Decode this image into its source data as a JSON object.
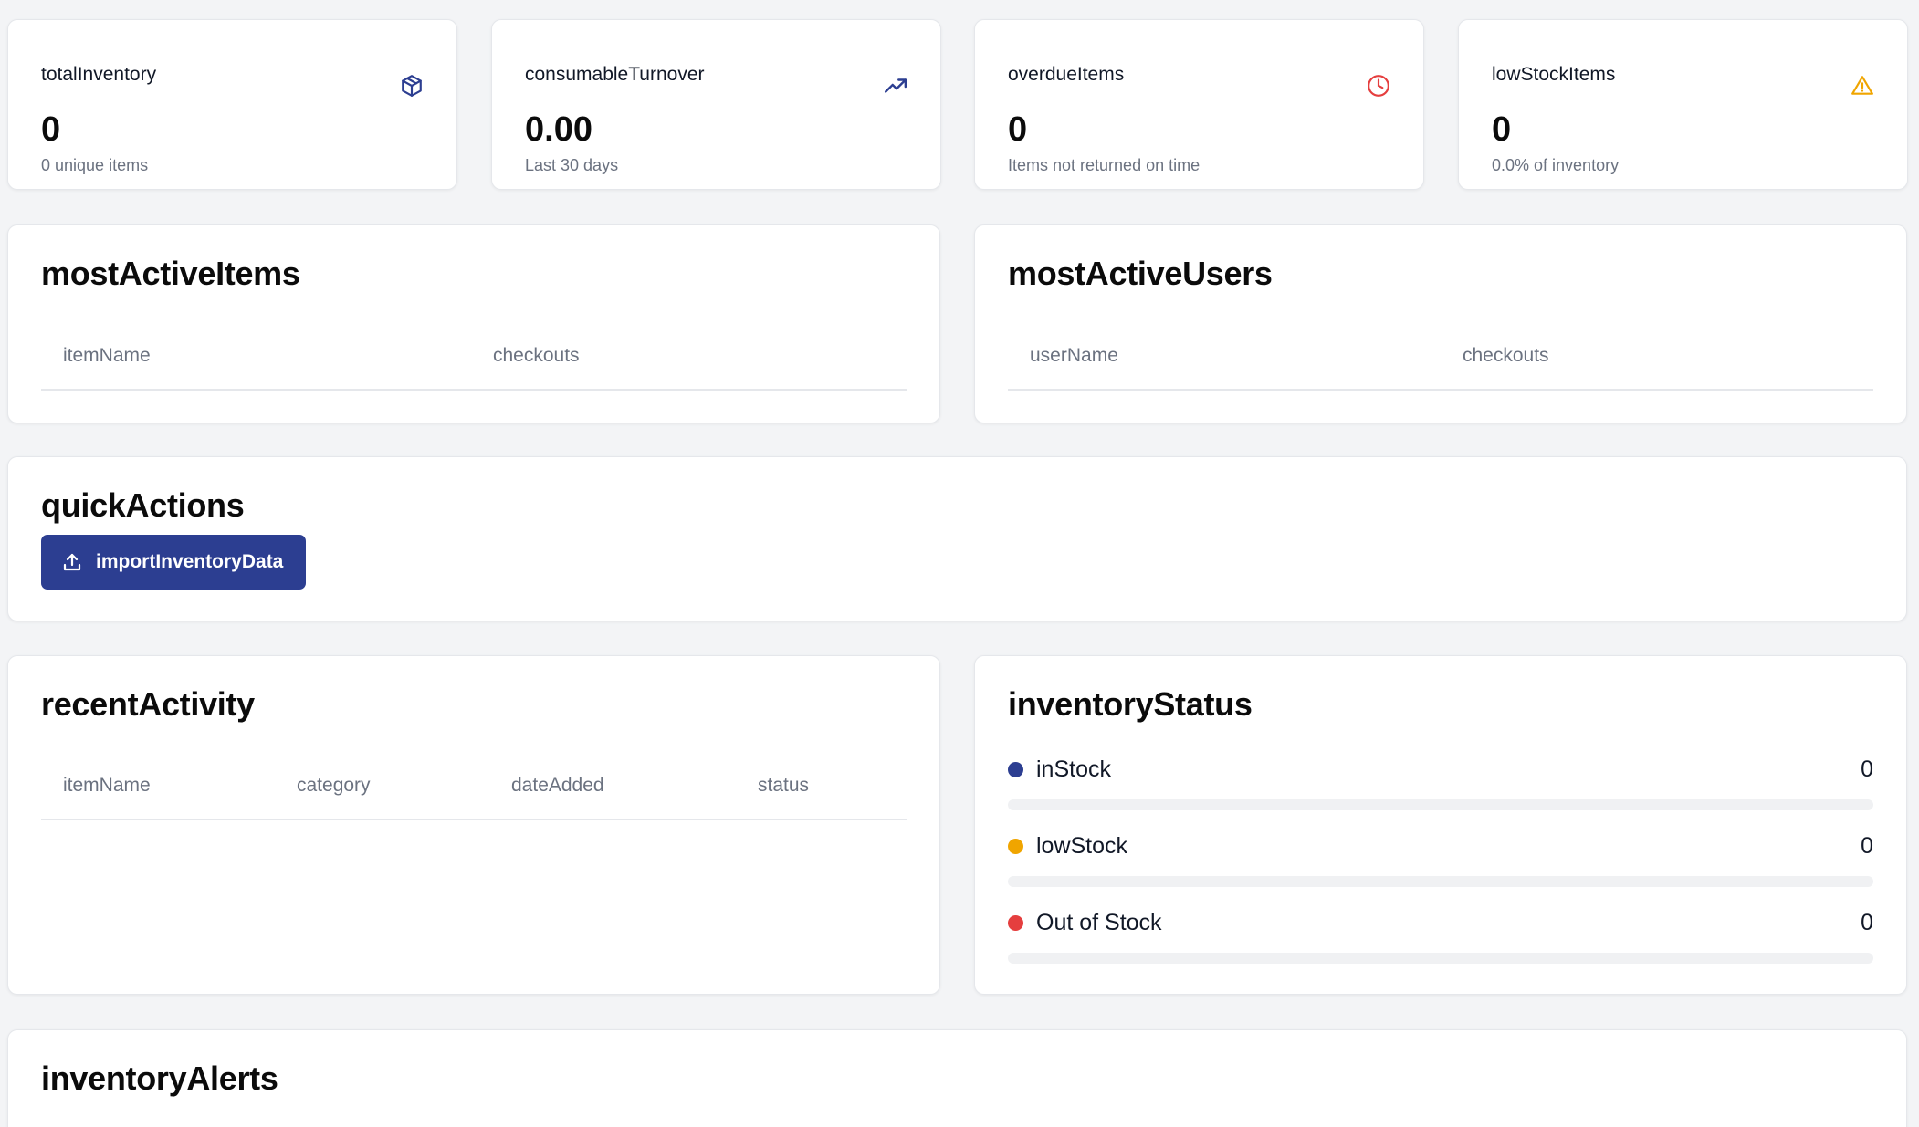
{
  "stats": [
    {
      "title": "totalInventory",
      "value": "0",
      "sub": "0 unique items",
      "icon": "box-icon",
      "icon_color": "#2c3e91"
    },
    {
      "title": "consumableTurnover",
      "value": "0.00",
      "sub": "Last 30 days",
      "icon": "trending-up-icon",
      "icon_color": "#2c3e91"
    },
    {
      "title": "overdueItems",
      "value": "0",
      "sub": "Items not returned on time",
      "icon": "clock-icon",
      "icon_color": "#e53e3e"
    },
    {
      "title": "lowStockItems",
      "value": "0",
      "sub": "0.0% of inventory",
      "icon": "warning-icon",
      "icon_color": "#f0a500"
    }
  ],
  "most_active_items": {
    "title": "mostActiveItems",
    "columns": [
      "itemName",
      "checkouts"
    ]
  },
  "most_active_users": {
    "title": "mostActiveUsers",
    "columns": [
      "userName",
      "checkouts"
    ]
  },
  "quick_actions": {
    "title": "quickActions",
    "import_label": "importInventoryData",
    "button_color": "#2c3e91"
  },
  "recent_activity": {
    "title": "recentActivity",
    "columns": [
      "itemName",
      "category",
      "dateAdded",
      "status"
    ]
  },
  "inventory_status": {
    "title": "inventoryStatus",
    "rows": [
      {
        "label": "inStock",
        "count": "0",
        "fraction": 0,
        "color": "#2c3e91"
      },
      {
        "label": "lowStock",
        "count": "0",
        "fraction": 0,
        "color": "#f0a500"
      },
      {
        "label": "Out of Stock",
        "count": "0",
        "fraction": 0,
        "color": "#e53e3e"
      }
    ]
  },
  "inventory_alerts": {
    "title": "inventoryAlerts"
  }
}
